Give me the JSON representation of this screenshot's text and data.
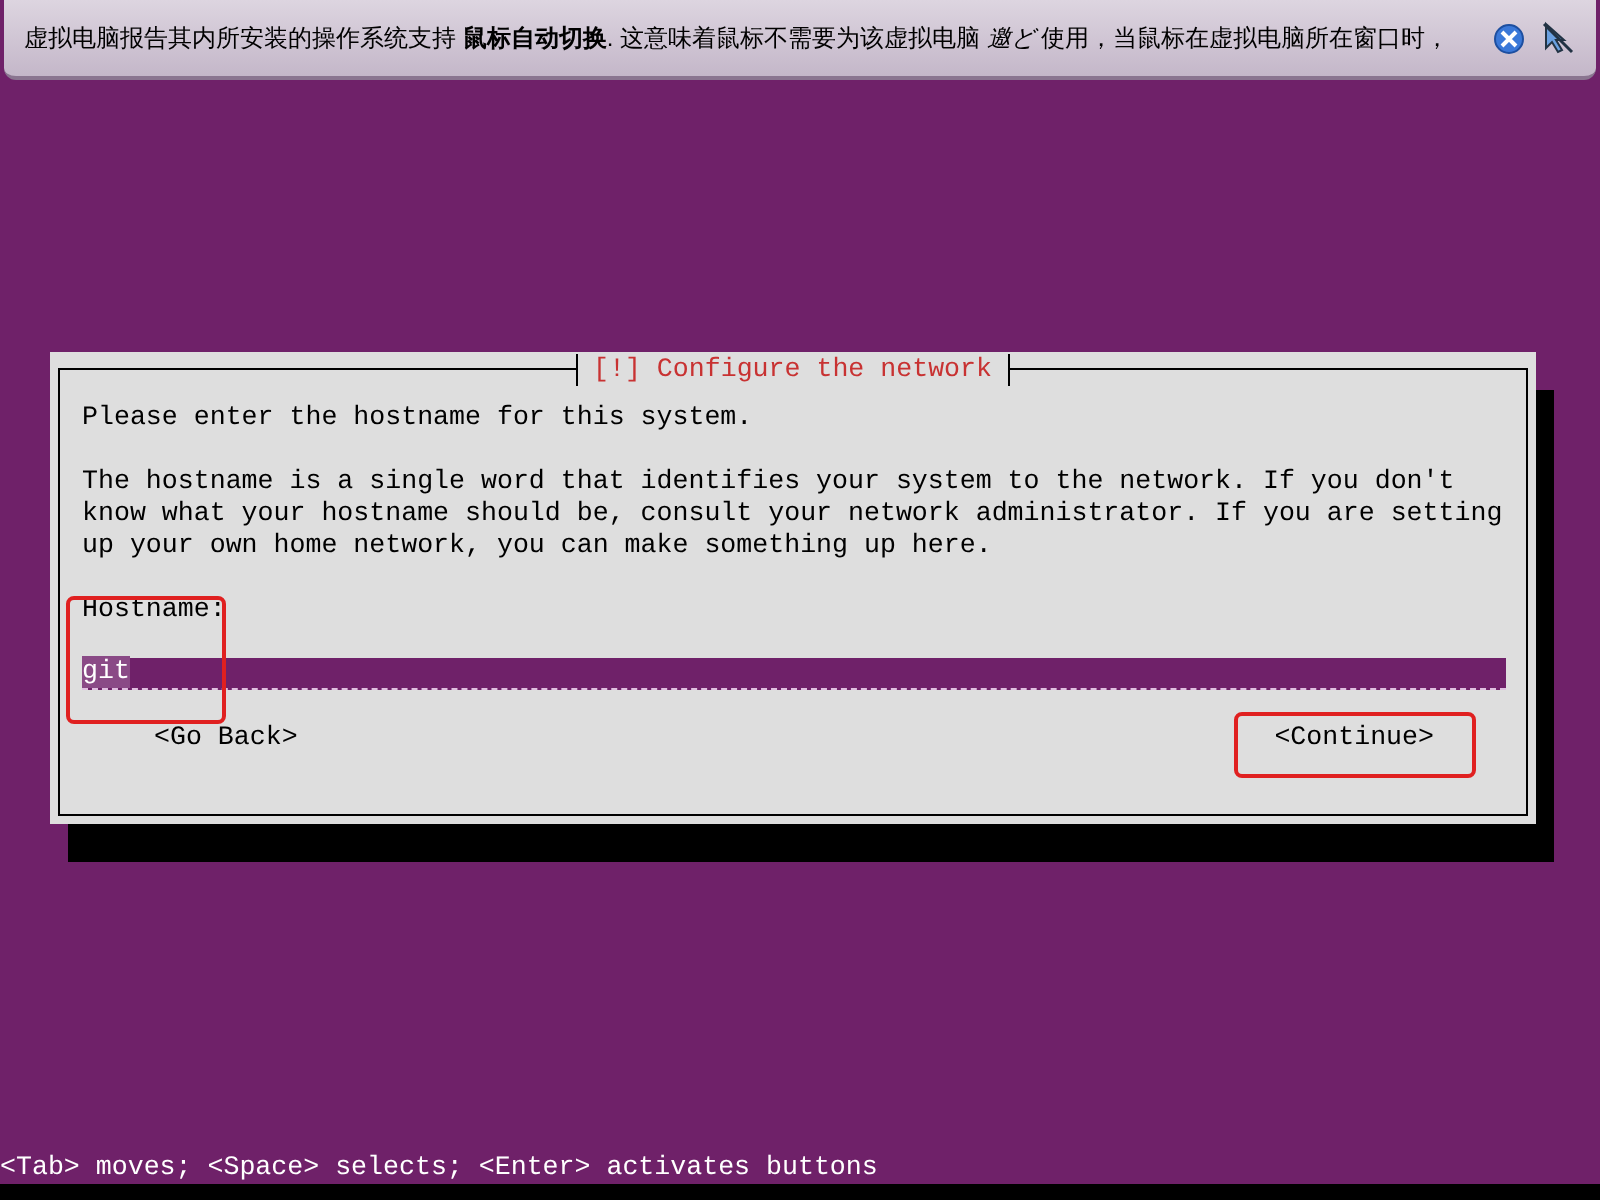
{
  "notification": {
    "text": "虚拟电脑报告其内所安装的操作系统支持 **鼠标自动切换**. 这意味着鼠标不需要为该虚拟电脑 *邀ど* 使用，当鼠标在虚拟电脑所在窗口时，"
  },
  "dialog": {
    "title": "[!] Configure the network",
    "paragraphs": [
      "Please enter the hostname for this system.",
      "The hostname is a single word that identifies your system to the network. If you don't know what your hostname should be, consult your network administrator. If you are setting up your own home network, you can make something up here."
    ],
    "field_label": "Hostname:",
    "field_value": "git",
    "buttons": [
      "<Go Back>",
      "<Continue>"
    ]
  },
  "status_bar": "<Tab> moves; <Space> selects; <Enter> activates buttons"
}
